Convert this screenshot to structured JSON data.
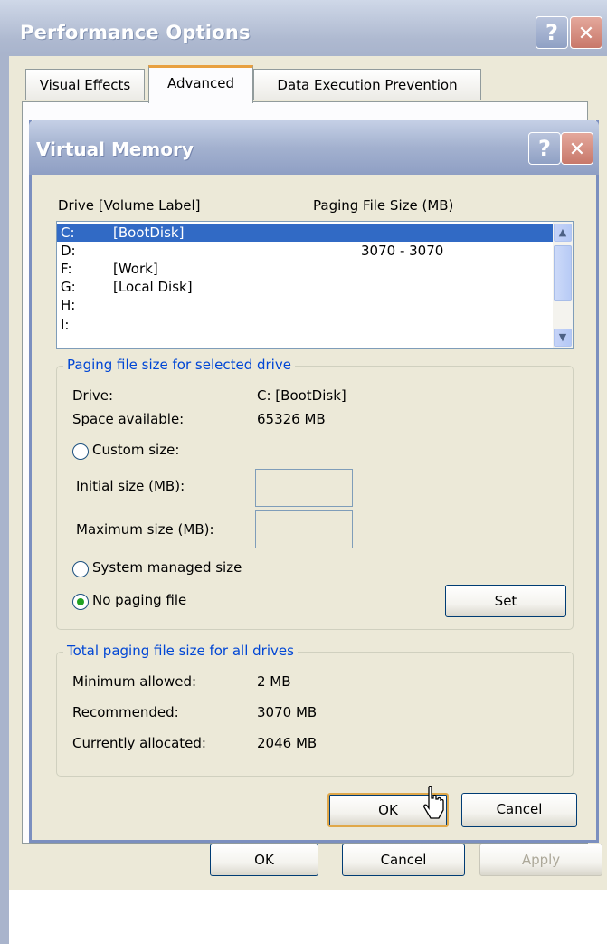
{
  "outer_window": {
    "title": "Performance Options",
    "tabs": [
      {
        "label": "Visual Effects",
        "active": false
      },
      {
        "label": "Advanced",
        "active": true
      },
      {
        "label": "Data Execution Prevention",
        "active": false
      }
    ],
    "buttons": {
      "ok": "OK",
      "cancel": "Cancel",
      "apply": "Apply"
    },
    "help_glyph": "?",
    "close_glyph": "✕"
  },
  "virtual_memory": {
    "title": "Virtual Memory",
    "help_glyph": "?",
    "close_glyph": "✕",
    "list_headers": {
      "drive": "Drive  [Volume Label]",
      "size": "Paging File Size (MB)"
    },
    "drives": [
      {
        "drive": "C:",
        "label": "[BootDisk]",
        "size": "",
        "selected": true
      },
      {
        "drive": "D:",
        "label": "",
        "size": "3070 - 3070",
        "selected": false
      },
      {
        "drive": "F:",
        "label": "[Work]",
        "size": "",
        "selected": false
      },
      {
        "drive": "G:",
        "label": "[Local Disk]",
        "size": "",
        "selected": false
      },
      {
        "drive": "H:",
        "label": "",
        "size": "",
        "selected": false
      },
      {
        "drive": "I:",
        "label": "",
        "size": "",
        "selected": false
      }
    ],
    "selected_group": {
      "legend": "Paging file size for selected drive",
      "drive_label": "Drive:",
      "drive_value": "C:  [BootDisk]",
      "space_label": "Space available:",
      "space_value": "65326 MB",
      "custom_size": "Custom size:",
      "initial_size": "Initial size (MB):",
      "initial_value": "",
      "maximum_size": "Maximum size (MB):",
      "maximum_value": "",
      "system_managed": "System managed size",
      "no_paging": "No paging file",
      "selected_option": "no_paging",
      "set_button": "Set"
    },
    "total_group": {
      "legend": "Total paging file size for all drives",
      "minimum_label": "Minimum allowed:",
      "minimum_value": "2 MB",
      "recommended_label": "Recommended:",
      "recommended_value": "3070 MB",
      "allocated_label": "Currently allocated:",
      "allocated_value": "2046 MB"
    },
    "buttons": {
      "ok": "OK",
      "cancel": "Cancel"
    }
  },
  "colors": {
    "selection": "#316ac5",
    "group_legend": "#0046d5",
    "dialog_bg": "#ece9d8",
    "radio_checked": "#21a121"
  }
}
